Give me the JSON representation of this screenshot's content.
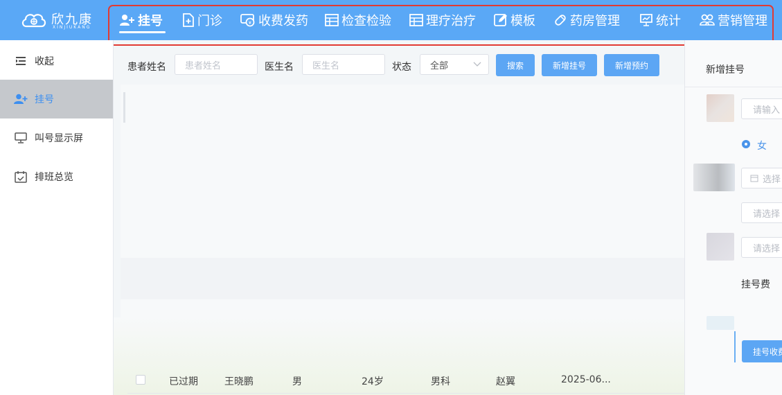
{
  "app": {
    "logo_name": "欣九康",
    "logo_sub": "XINJIUKANG",
    "colors": {
      "topbar": "#5aa8f6",
      "accent": "#3d8ff0",
      "highlight_border": "#e23a32"
    }
  },
  "nav": {
    "items": [
      {
        "label": "挂号",
        "icon": "add-user-icon",
        "active": true
      },
      {
        "label": "门诊",
        "icon": "file-plus-icon"
      },
      {
        "label": "收费发药",
        "icon": "money-icon"
      },
      {
        "label": "检查检验",
        "icon": "table-icon"
      },
      {
        "label": "理疗治疗",
        "icon": "table-icon"
      },
      {
        "label": "模板",
        "icon": "edit-icon"
      },
      {
        "label": "药房管理",
        "icon": "pill-icon"
      },
      {
        "label": "统计",
        "icon": "chart-icon"
      },
      {
        "label": "营销管理",
        "icon": "users-icon"
      }
    ]
  },
  "sidebar": {
    "items": [
      {
        "label": "收起",
        "icon": "collapse-icon"
      },
      {
        "label": "挂号",
        "icon": "add-user-icon",
        "active": true
      },
      {
        "label": "叫号显示屏",
        "icon": "monitor-icon"
      },
      {
        "label": "排班总览",
        "icon": "calendar-icon"
      }
    ]
  },
  "filters": {
    "patient_label": "患者姓名",
    "patient_placeholder": "患者姓名",
    "doctor_label": "医生名",
    "doctor_placeholder": "医生名",
    "status_label": "状态",
    "status_value": "全部",
    "search_button": "搜索",
    "new_registration_button": "新增挂号",
    "new_appointment_button": "新增预约"
  },
  "table": {
    "rows": [
      {
        "status": "已过期",
        "name": "王晓鹏",
        "gender": "男",
        "age": "24岁",
        "dept": "男科",
        "doctor": "赵翼",
        "date": "2025-06..."
      }
    ]
  },
  "right_panel": {
    "title": "新增挂号",
    "name_placeholder": "请输入",
    "gender_option": "女",
    "date_placeholder": "选择",
    "select1_placeholder": "请选择",
    "select2_placeholder": "请选择",
    "fee_label": "挂号费",
    "submit_button": "挂号收费"
  }
}
